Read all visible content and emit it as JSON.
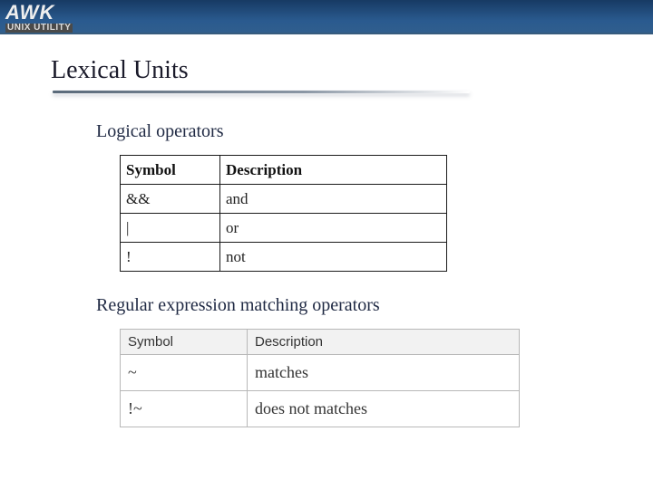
{
  "logo": {
    "main": "AWK",
    "sub": "UNIX UTILITY"
  },
  "title": "Lexical Units",
  "section1": {
    "heading": "Logical operators",
    "cols": {
      "c1": "Symbol",
      "c2": "Description"
    },
    "rows": [
      {
        "sym": "&&",
        "desc": "and"
      },
      {
        "sym": "|",
        "desc": "or"
      },
      {
        "sym": "!",
        "desc": "not"
      }
    ]
  },
  "section2": {
    "heading": "Regular expression matching operators",
    "cols": {
      "c1": "Symbol",
      "c2": "Description"
    },
    "rows": [
      {
        "sym": "~",
        "desc": "matches"
      },
      {
        "sym": "!~",
        "desc": "does not matches"
      }
    ]
  }
}
